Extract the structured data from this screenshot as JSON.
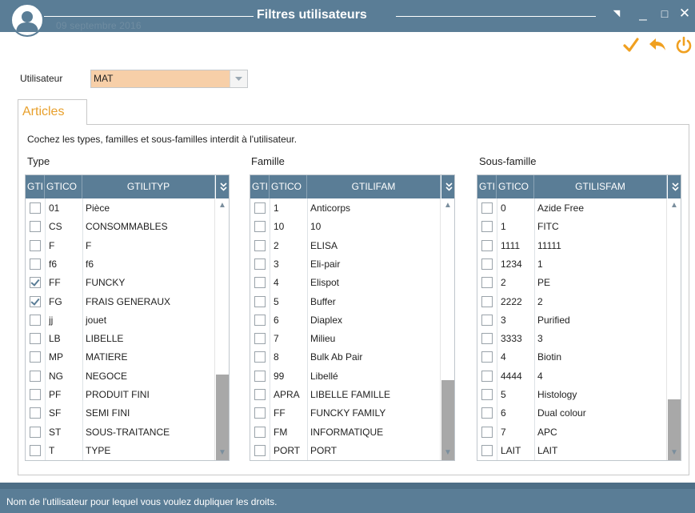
{
  "window": {
    "title": "Filtres utilisateurs",
    "ghost_date": "09 septembre 2016",
    "buttons": {
      "pin": "◥",
      "minimize": "_",
      "maximize": "□",
      "close": "✕"
    }
  },
  "toolbar": {
    "validate_icon": "checkmark-icon",
    "back_icon": "undo-arrow-icon",
    "quit_icon": "power-icon",
    "accent_color": "#f0a020"
  },
  "form": {
    "user_label": "Utilisateur",
    "user_value": "MAT"
  },
  "tab": {
    "label": "Articles"
  },
  "instructions": "Cochez les types, familles et sous-familles interdit à l'utilisateur.",
  "type_grid": {
    "label": "Type",
    "headers": [
      "GTI",
      "GTICO",
      "GTILITYP"
    ],
    "rows": [
      {
        "checked": false,
        "code": "01",
        "label": "Pièce"
      },
      {
        "checked": false,
        "code": "CS",
        "label": "CONSOMMABLES"
      },
      {
        "checked": false,
        "code": "F",
        "label": "F"
      },
      {
        "checked": false,
        "code": "f6",
        "label": "f6"
      },
      {
        "checked": true,
        "code": "FF",
        "label": "FUNCKY"
      },
      {
        "checked": true,
        "code": "FG",
        "label": "FRAIS GENERAUX"
      },
      {
        "checked": false,
        "code": "jj",
        "label": "jouet"
      },
      {
        "checked": false,
        "code": "LB",
        "label": "LIBELLE"
      },
      {
        "checked": false,
        "code": "MP",
        "label": "MATIERE"
      },
      {
        "checked": false,
        "code": "NG",
        "label": "NEGOCE"
      },
      {
        "checked": false,
        "code": "PF",
        "label": "PRODUIT FINI"
      },
      {
        "checked": false,
        "code": "SF",
        "label": "SEMI FINI"
      },
      {
        "checked": false,
        "code": "ST",
        "label": "SOUS-TRAITANCE"
      },
      {
        "checked": false,
        "code": "T",
        "label": "TYPE"
      }
    ]
  },
  "famille_grid": {
    "label": "Famille",
    "headers": [
      "GTI",
      "GTICO",
      "GTILIFAM"
    ],
    "rows": [
      {
        "checked": false,
        "code": "1",
        "label": "Anticorps"
      },
      {
        "checked": false,
        "code": "10",
        "label": "10"
      },
      {
        "checked": false,
        "code": "2",
        "label": "ELISA"
      },
      {
        "checked": false,
        "code": "3",
        "label": "Eli-pair"
      },
      {
        "checked": false,
        "code": "4",
        "label": "Elispot"
      },
      {
        "checked": false,
        "code": "5",
        "label": "Buffer"
      },
      {
        "checked": false,
        "code": "6",
        "label": "Diaplex"
      },
      {
        "checked": false,
        "code": "7",
        "label": "Milieu"
      },
      {
        "checked": false,
        "code": "8",
        "label": "Bulk Ab Pair"
      },
      {
        "checked": false,
        "code": "99",
        "label": "Libellé"
      },
      {
        "checked": false,
        "code": "APRA",
        "label": "LIBELLE FAMILLE"
      },
      {
        "checked": false,
        "code": "FF",
        "label": "FUNCKY FAMILY"
      },
      {
        "checked": false,
        "code": "FM",
        "label": "INFORMATIQUE"
      },
      {
        "checked": false,
        "code": "PORT",
        "label": "PORT"
      }
    ]
  },
  "sousfamille_grid": {
    "label": "Sous-famille",
    "headers": [
      "GTI",
      "GTICO",
      "GTILISFAM"
    ],
    "rows": [
      {
        "checked": false,
        "code": "0",
        "label": "Azide Free"
      },
      {
        "checked": false,
        "code": "1",
        "label": "FITC"
      },
      {
        "checked": false,
        "code": "1111",
        "label": "11111"
      },
      {
        "checked": false,
        "code": "1234",
        "label": "1"
      },
      {
        "checked": false,
        "code": "2",
        "label": "PE"
      },
      {
        "checked": false,
        "code": "2222",
        "label": "2"
      },
      {
        "checked": false,
        "code": "3",
        "label": "Purified"
      },
      {
        "checked": false,
        "code": "3333",
        "label": "3"
      },
      {
        "checked": false,
        "code": "4",
        "label": "Biotin"
      },
      {
        "checked": false,
        "code": "4444",
        "label": "4"
      },
      {
        "checked": false,
        "code": "5",
        "label": "Histology"
      },
      {
        "checked": false,
        "code": "6",
        "label": "Dual colour"
      },
      {
        "checked": false,
        "code": "7",
        "label": "APC"
      },
      {
        "checked": false,
        "code": "LAIT",
        "label": "LAIT"
      }
    ]
  },
  "status": "Nom de l'utilisateur pour lequel vous voulez dupliquer les droits."
}
